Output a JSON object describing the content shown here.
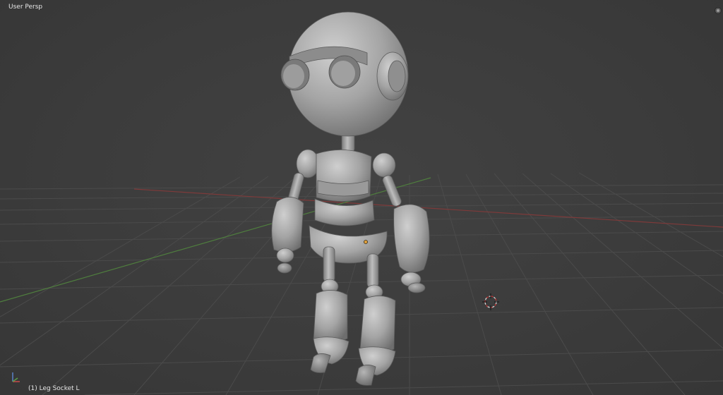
{
  "viewport": {
    "view_name": "User Persp",
    "active_object": "(1) Leg Socket L"
  },
  "icons": {
    "cursor": "3d-cursor-icon",
    "axes": "axis-gizmo-icon",
    "region": "region-toggle-icon"
  },
  "colors": {
    "background": "#3d3d3d",
    "grid": "#4a4a4a",
    "x_axis": "#8a3a3a",
    "y_axis": "#4a7a3a",
    "model": "#a6a6a6",
    "text": "#e6e6e6"
  }
}
